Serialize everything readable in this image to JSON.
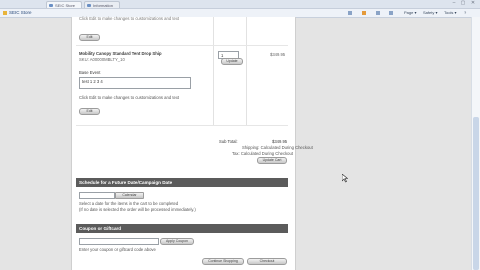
{
  "browser": {
    "tabs": [
      {
        "label": "SEIC Store"
      },
      {
        "label": "Information"
      }
    ],
    "favorites_label": "SEIC Store",
    "tools": {
      "page": "Page ▾",
      "safety": "Safety ▾",
      "tools": "Tools ▾",
      "help": "?"
    },
    "window_controls": {
      "min": "–",
      "max": "▢",
      "close": "✕"
    }
  },
  "cart": {
    "item1_note": "Click Edit to make changes to customizations and text",
    "edit_label": "Edit",
    "item2_name": "Mobility Canopy Standard Tent Drop Ship",
    "item2_sku": "SKU: A00000MBLTY_10",
    "item2_option_label": "Base Event",
    "item2_option_value": "test 1 2 3 4",
    "item2_note": "Click Edit to make changes to customizations and text",
    "item2_qty": "1",
    "item2_update_label": "Update",
    "item2_price": "$349.95"
  },
  "totals": {
    "subtotal_label": "Sub Total:",
    "subtotal_value": "$349.95",
    "shipping_label": "Shipping: Calculated During Checkout",
    "tax_label": "Tax: Calculated During Checkout",
    "update_cart_label": "Update Cart"
  },
  "schedule": {
    "header": "Schedule for a Future Date/Campaign Date",
    "calendar_label": "Calendar",
    "help_line1": "Select a date for the items in the cart to be completed",
    "help_line2": "(If no date is selected the order will be processed immediately.)"
  },
  "coupon": {
    "header": "Coupon or Giftcard",
    "help": "Enter your coupon or giftcard code above",
    "apply_label": "Apply Coupon"
  },
  "actions": {
    "continue_label": "Continue Shopping",
    "checkout_label": "Checkout"
  }
}
